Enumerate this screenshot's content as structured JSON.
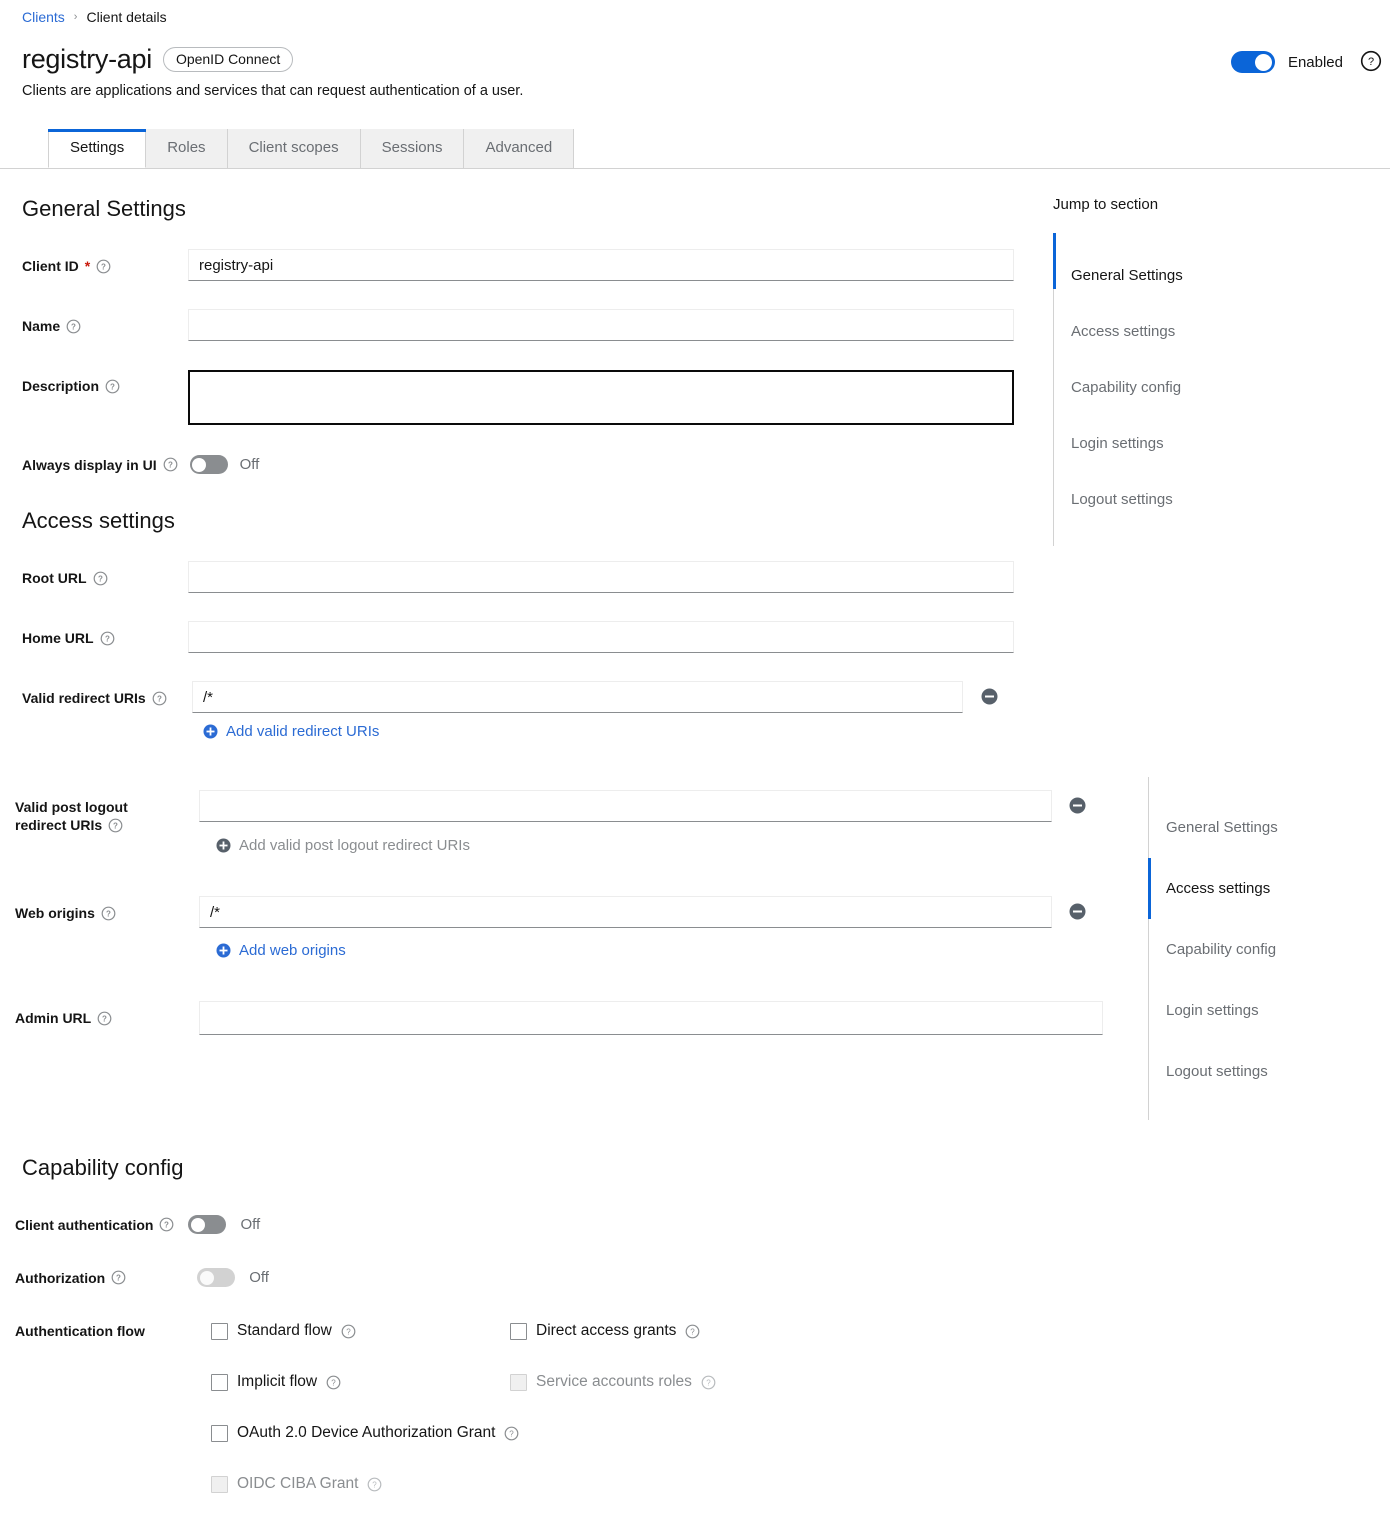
{
  "breadcrumb": {
    "parent": "Clients",
    "separator": "›",
    "current": "Client details"
  },
  "header": {
    "title": "registry-api",
    "protocol_badge": "OpenID Connect",
    "subtitle": "Clients are applications and services that can request authentication of a user.",
    "enabled_label": "Enabled",
    "enabled_state": true,
    "help_icon": "help-circle-icon"
  },
  "tabs": [
    {
      "label": "Settings",
      "active": true
    },
    {
      "label": "Roles",
      "active": false
    },
    {
      "label": "Client scopes",
      "active": false
    },
    {
      "label": "Sessions",
      "active": false
    },
    {
      "label": "Advanced",
      "active": false
    }
  ],
  "general_settings": {
    "heading": "General Settings",
    "client_id": {
      "label": "Client ID",
      "required": "*",
      "value": "registry-api",
      "placeholder": ""
    },
    "name": {
      "label": "Name",
      "value": "",
      "placeholder": ""
    },
    "description": {
      "label": "Description",
      "value": "",
      "placeholder": "",
      "focused": true
    },
    "always_display": {
      "label": "Always display in UI",
      "state": "Off",
      "on": false
    }
  },
  "access_settings": {
    "heading": "Access settings",
    "root_url": {
      "label": "Root URL",
      "value": "",
      "placeholder": ""
    },
    "home_url": {
      "label": "Home URL",
      "value": "",
      "placeholder": ""
    },
    "valid_redirect_uris": {
      "label": "Valid redirect URIs",
      "value": "/*",
      "add_label": "Add valid redirect URIs",
      "remove_icon": "minus-circle-icon"
    },
    "valid_post_logout": {
      "label_line1": "Valid post logout",
      "label_line2": "redirect URIs",
      "value": "",
      "add_label": "Add valid post logout redirect URIs",
      "add_disabled": true,
      "remove_icon": "minus-circle-icon"
    },
    "web_origins": {
      "label": "Web origins",
      "value": "/*",
      "add_label": "Add web origins",
      "remove_icon": "minus-circle-icon"
    },
    "admin_url": {
      "label": "Admin URL",
      "value": "",
      "placeholder": ""
    }
  },
  "capability_config": {
    "heading": "Capability config",
    "client_authentication": {
      "label": "Client authentication",
      "state": "Off",
      "on": false,
      "disabled": false
    },
    "authorization": {
      "label": "Authorization",
      "state": "Off",
      "on": false,
      "disabled": true
    },
    "auth_flow_label": "Authentication flow",
    "flows": [
      {
        "label": "Standard flow",
        "checked": false,
        "disabled": false
      },
      {
        "label": "Direct access grants",
        "checked": false,
        "disabled": false
      },
      {
        "label": "Implicit flow",
        "checked": false,
        "disabled": false
      },
      {
        "label": "Service accounts roles",
        "checked": false,
        "disabled": true
      },
      {
        "label": "OAuth 2.0 Device Authorization Grant",
        "checked": false,
        "disabled": false
      },
      {
        "label": "OIDC CIBA Grant",
        "checked": false,
        "disabled": true
      }
    ]
  },
  "jump_nav_primary": {
    "title": "Jump to section",
    "items": [
      {
        "label": "General Settings",
        "active": true
      },
      {
        "label": "Access settings",
        "active": false
      },
      {
        "label": "Capability config",
        "active": false
      },
      {
        "label": "Login settings",
        "active": false
      },
      {
        "label": "Logout settings",
        "active": false
      }
    ]
  },
  "jump_nav_secondary": {
    "items": [
      {
        "label": "General Settings",
        "active": false
      },
      {
        "label": "Access settings",
        "active": true
      },
      {
        "label": "Capability config",
        "active": false
      },
      {
        "label": "Login settings",
        "active": false
      },
      {
        "label": "Logout settings",
        "active": false
      }
    ]
  }
}
